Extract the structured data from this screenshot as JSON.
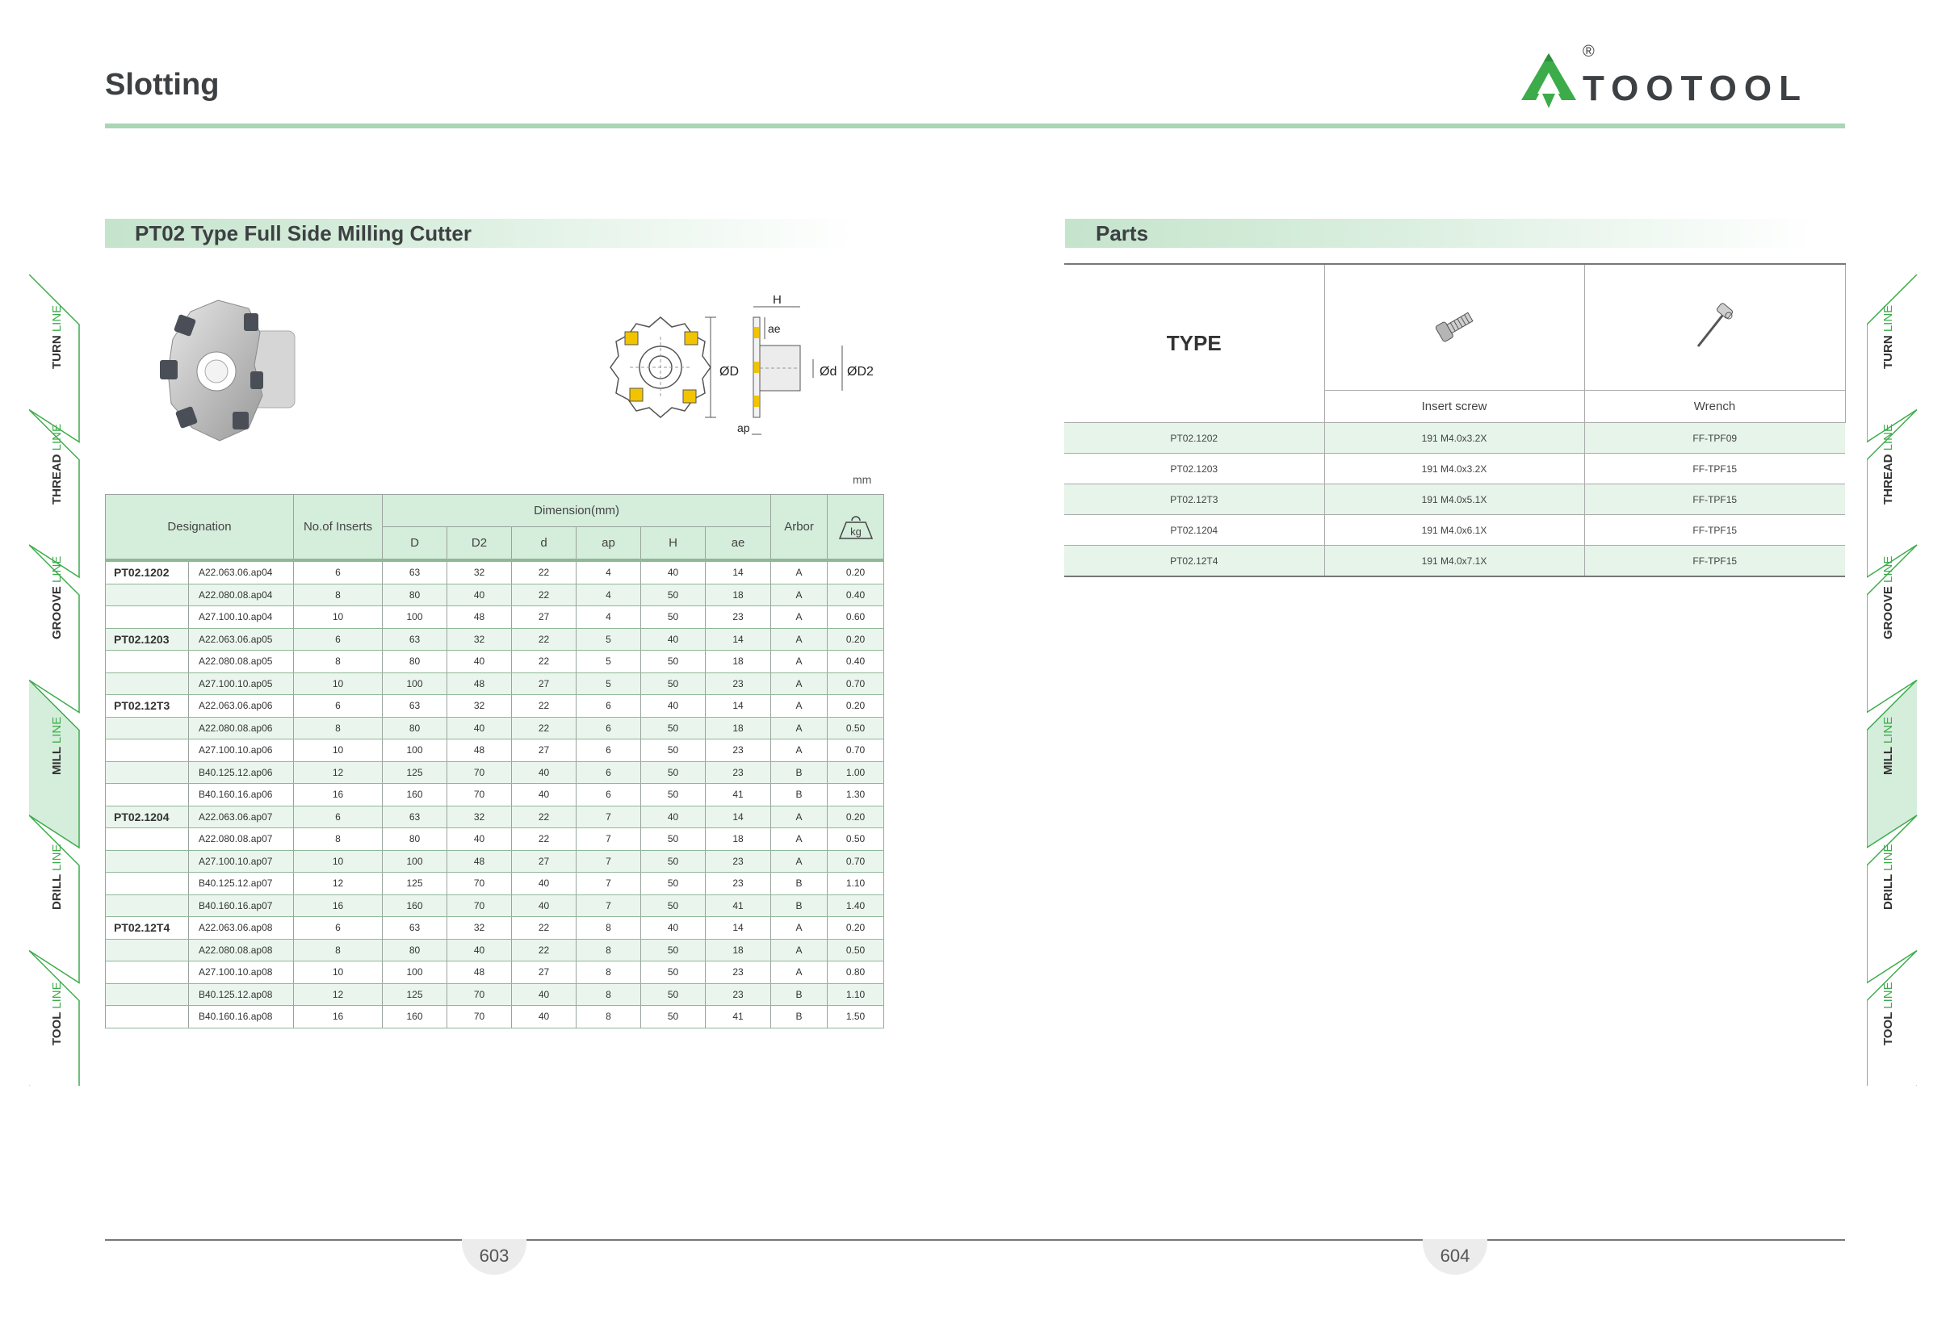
{
  "header": {
    "title": "Slotting",
    "logo_text": "TOOTOOL",
    "logo_mark": "®"
  },
  "left_section": {
    "title": "PT02 Type Full Side Milling Cutter"
  },
  "right_section": {
    "title": "Parts"
  },
  "diagram_labels": {
    "H": "H",
    "ae": "ae",
    "D": "ØD",
    "d": "Ød",
    "D2": "ØD2",
    "ap": "ap"
  },
  "unit": "mm",
  "spec_table": {
    "headers": {
      "designation": "Designation",
      "inserts": "No.of Inserts",
      "dimension": "Dimension(mm)",
      "arbor": "Arbor",
      "weight": "kg"
    },
    "dim_headers": [
      "D",
      "D2",
      "d",
      "ap",
      "H",
      "ae"
    ],
    "rows": [
      {
        "group": "PT02.1202",
        "des": "A22.063.06.ap04",
        "ins": "6",
        "D": "63",
        "D2": "32",
        "d": "22",
        "ap": "4",
        "H": "40",
        "ae": "14",
        "arbor": "A",
        "kg": "0.20"
      },
      {
        "group": "",
        "des": "A22.080.08.ap04",
        "ins": "8",
        "D": "80",
        "D2": "40",
        "d": "22",
        "ap": "4",
        "H": "50",
        "ae": "18",
        "arbor": "A",
        "kg": "0.40"
      },
      {
        "group": "",
        "des": "A27.100.10.ap04",
        "ins": "10",
        "D": "100",
        "D2": "48",
        "d": "27",
        "ap": "4",
        "H": "50",
        "ae": "23",
        "arbor": "A",
        "kg": "0.60"
      },
      {
        "group": "PT02.1203",
        "des": "A22.063.06.ap05",
        "ins": "6",
        "D": "63",
        "D2": "32",
        "d": "22",
        "ap": "5",
        "H": "40",
        "ae": "14",
        "arbor": "A",
        "kg": "0.20"
      },
      {
        "group": "",
        "des": "A22.080.08.ap05",
        "ins": "8",
        "D": "80",
        "D2": "40",
        "d": "22",
        "ap": "5",
        "H": "50",
        "ae": "18",
        "arbor": "A",
        "kg": "0.40"
      },
      {
        "group": "",
        "des": "A27.100.10.ap05",
        "ins": "10",
        "D": "100",
        "D2": "48",
        "d": "27",
        "ap": "5",
        "H": "50",
        "ae": "23",
        "arbor": "A",
        "kg": "0.70"
      },
      {
        "group": "PT02.12T3",
        "des": "A22.063.06.ap06",
        "ins": "6",
        "D": "63",
        "D2": "32",
        "d": "22",
        "ap": "6",
        "H": "40",
        "ae": "14",
        "arbor": "A",
        "kg": "0.20"
      },
      {
        "group": "",
        "des": "A22.080.08.ap06",
        "ins": "8",
        "D": "80",
        "D2": "40",
        "d": "22",
        "ap": "6",
        "H": "50",
        "ae": "18",
        "arbor": "A",
        "kg": "0.50"
      },
      {
        "group": "",
        "des": "A27.100.10.ap06",
        "ins": "10",
        "D": "100",
        "D2": "48",
        "d": "27",
        "ap": "6",
        "H": "50",
        "ae": "23",
        "arbor": "A",
        "kg": "0.70"
      },
      {
        "group": "",
        "des": "B40.125.12.ap06",
        "ins": "12",
        "D": "125",
        "D2": "70",
        "d": "40",
        "ap": "6",
        "H": "50",
        "ae": "23",
        "arbor": "B",
        "kg": "1.00"
      },
      {
        "group": "",
        "des": "B40.160.16.ap06",
        "ins": "16",
        "D": "160",
        "D2": "70",
        "d": "40",
        "ap": "6",
        "H": "50",
        "ae": "41",
        "arbor": "B",
        "kg": "1.30"
      },
      {
        "group": "PT02.1204",
        "des": "A22.063.06.ap07",
        "ins": "6",
        "D": "63",
        "D2": "32",
        "d": "22",
        "ap": "7",
        "H": "40",
        "ae": "14",
        "arbor": "A",
        "kg": "0.20"
      },
      {
        "group": "",
        "des": "A22.080.08.ap07",
        "ins": "8",
        "D": "80",
        "D2": "40",
        "d": "22",
        "ap": "7",
        "H": "50",
        "ae": "18",
        "arbor": "A",
        "kg": "0.50"
      },
      {
        "group": "",
        "des": "A27.100.10.ap07",
        "ins": "10",
        "D": "100",
        "D2": "48",
        "d": "27",
        "ap": "7",
        "H": "50",
        "ae": "23",
        "arbor": "A",
        "kg": "0.70"
      },
      {
        "group": "",
        "des": "B40.125.12.ap07",
        "ins": "12",
        "D": "125",
        "D2": "70",
        "d": "40",
        "ap": "7",
        "H": "50",
        "ae": "23",
        "arbor": "B",
        "kg": "1.10"
      },
      {
        "group": "",
        "des": "B40.160.16.ap07",
        "ins": "16",
        "D": "160",
        "D2": "70",
        "d": "40",
        "ap": "7",
        "H": "50",
        "ae": "41",
        "arbor": "B",
        "kg": "1.40"
      },
      {
        "group": "PT02.12T4",
        "des": "A22.063.06.ap08",
        "ins": "6",
        "D": "63",
        "D2": "32",
        "d": "22",
        "ap": "8",
        "H": "40",
        "ae": "14",
        "arbor": "A",
        "kg": "0.20"
      },
      {
        "group": "",
        "des": "A22.080.08.ap08",
        "ins": "8",
        "D": "80",
        "D2": "40",
        "d": "22",
        "ap": "8",
        "H": "50",
        "ae": "18",
        "arbor": "A",
        "kg": "0.50"
      },
      {
        "group": "",
        "des": "A27.100.10.ap08",
        "ins": "10",
        "D": "100",
        "D2": "48",
        "d": "27",
        "ap": "8",
        "H": "50",
        "ae": "23",
        "arbor": "A",
        "kg": "0.80"
      },
      {
        "group": "",
        "des": "B40.125.12.ap08",
        "ins": "12",
        "D": "125",
        "D2": "70",
        "d": "40",
        "ap": "8",
        "H": "50",
        "ae": "23",
        "arbor": "B",
        "kg": "1.10"
      },
      {
        "group": "",
        "des": "B40.160.16.ap08",
        "ins": "16",
        "D": "160",
        "D2": "70",
        "d": "40",
        "ap": "8",
        "H": "50",
        "ae": "41",
        "arbor": "B",
        "kg": "1.50"
      }
    ]
  },
  "parts_table": {
    "type_label": "TYPE",
    "col1_label": "Insert screw",
    "col2_label": "Wrench",
    "rows": [
      {
        "type": "PT02.1202",
        "screw": "191 M4.0x3.2X",
        "wrench": "FF-TPF09"
      },
      {
        "type": "PT02.1203",
        "screw": "191 M4.0x3.2X",
        "wrench": "FF-TPF15"
      },
      {
        "type": "PT02.12T3",
        "screw": "191 M4.0x5.1X",
        "wrench": "FF-TPF15"
      },
      {
        "type": "PT02.1204",
        "screw": "191 M4.0x6.1X",
        "wrench": "FF-TPF15"
      },
      {
        "type": "PT02.12T4",
        "screw": "191 M4.0x7.1X",
        "wrench": "FF-TPF15"
      }
    ]
  },
  "footer": {
    "page_left": "603",
    "page_right": "604"
  },
  "side_tabs": [
    {
      "name": "TURN",
      "line": "LINE"
    },
    {
      "name": "THREAD",
      "line": "LINE"
    },
    {
      "name": "GROOVE",
      "line": "LINE"
    },
    {
      "name": "MILL",
      "line": "LINE"
    },
    {
      "name": "DRILL",
      "line": "LINE"
    },
    {
      "name": "TOOL",
      "line": "LINE"
    }
  ],
  "active_tab": "MILL",
  "colors": {
    "accent": "#3cac4a",
    "band": "#c5e4cc",
    "row_alt": "#eaf6ed",
    "insert_yellow": "#f2c400"
  }
}
